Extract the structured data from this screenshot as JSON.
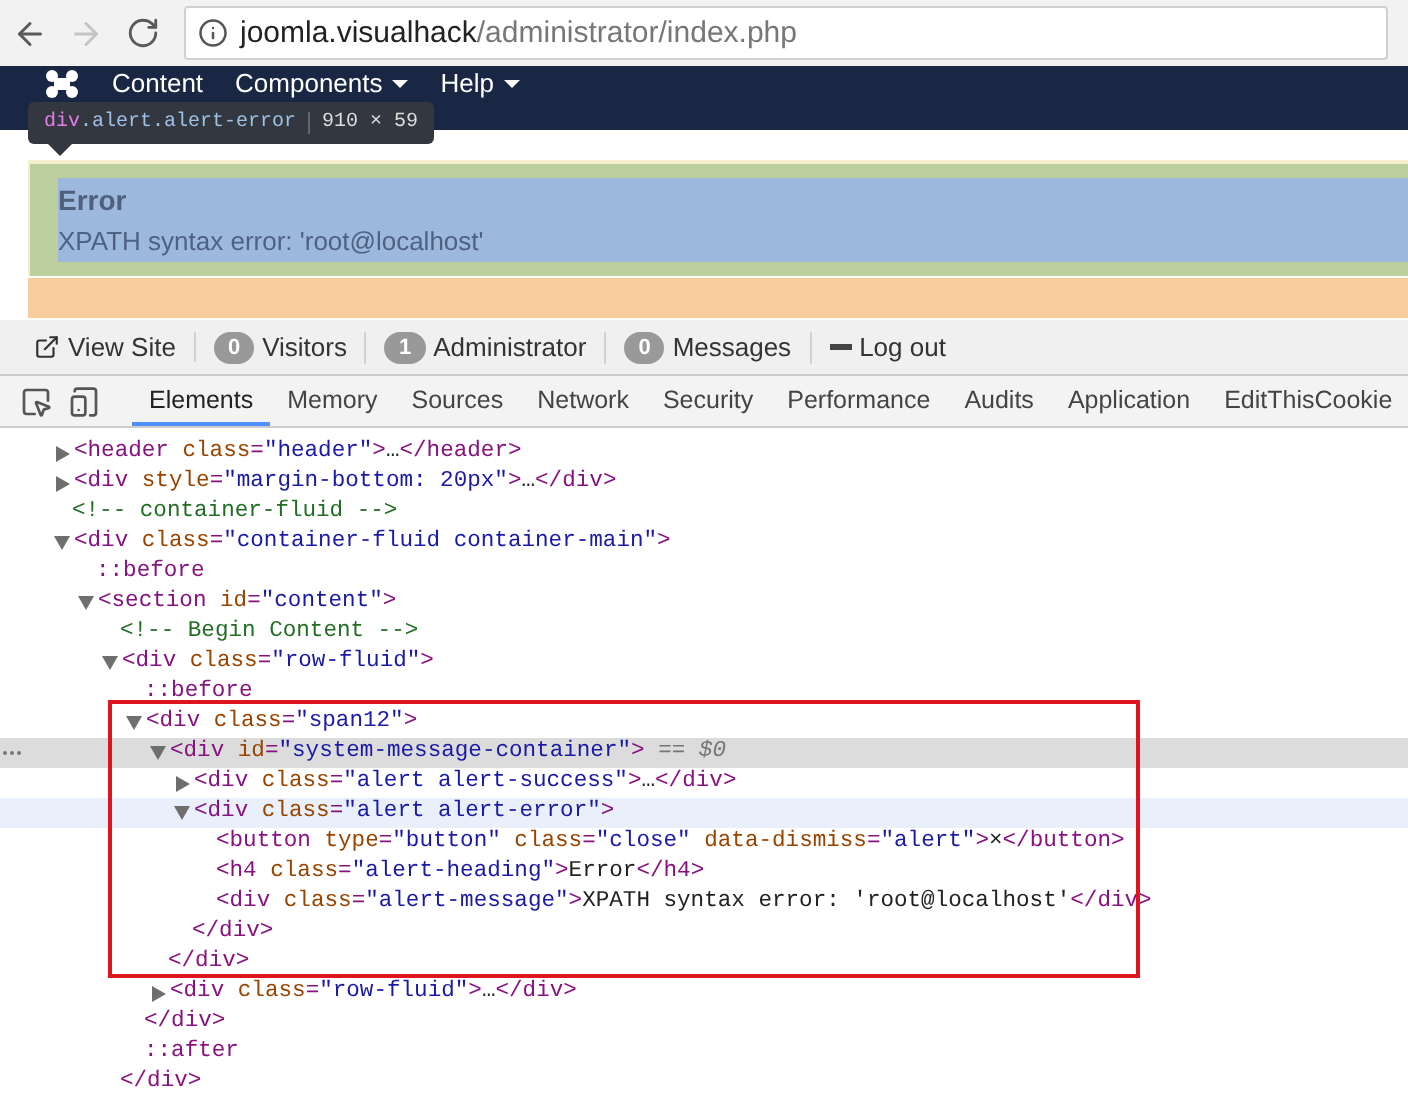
{
  "browser": {
    "back_disabled": false,
    "forward_disabled": true,
    "url_host": "joomla.visualhack",
    "url_path": "/administrator/index.php"
  },
  "navbar": {
    "items": [
      {
        "label": "Content",
        "dropdown": false
      },
      {
        "label": "Components",
        "dropdown": true
      },
      {
        "label": "Help",
        "dropdown": true
      }
    ]
  },
  "inspect_tooltip": {
    "tag": "div",
    "classes": ".alert.alert-error",
    "size": "910 × 59"
  },
  "alert": {
    "heading": "Error",
    "message": "XPATH syntax error: 'root@localhost'"
  },
  "status_bar": [
    {
      "kind": "link",
      "label": "View Site"
    },
    {
      "kind": "count",
      "count": "0",
      "label": "Visitors"
    },
    {
      "kind": "count",
      "count": "1",
      "label": "Administrator"
    },
    {
      "kind": "count",
      "count": "0",
      "label": "Messages"
    },
    {
      "kind": "logout",
      "label": "Log out"
    }
  ],
  "devtools_tabs": [
    {
      "label": "Elements",
      "selected": true
    },
    {
      "label": "Memory",
      "selected": false
    },
    {
      "label": "Sources",
      "selected": false
    },
    {
      "label": "Network",
      "selected": false
    },
    {
      "label": "Security",
      "selected": false
    },
    {
      "label": "Performance",
      "selected": false
    },
    {
      "label": "Audits",
      "selected": false
    },
    {
      "label": "Application",
      "selected": false
    },
    {
      "label": "EditThisCookie",
      "selected": false
    }
  ],
  "dom": [
    {
      "kind": "element",
      "text": "<header class=\"header\">…</header>",
      "expanded": false,
      "selected": false,
      "hovered": false
    },
    {
      "kind": "element",
      "text": "<div style=\"margin-bottom: 20px\">…</div>",
      "expanded": false,
      "selected": false,
      "hovered": false
    },
    {
      "kind": "comment",
      "text": "<!-- container-fluid -->",
      "selected": false,
      "hovered": false
    },
    {
      "kind": "element",
      "text": "<div class=\"container-fluid container-main\">",
      "expanded": true,
      "selected": false,
      "hovered": false,
      "children": [
        {
          "kind": "pseudo",
          "text": "::before",
          "selected": false,
          "hovered": false
        },
        {
          "kind": "element",
          "text": "<section id=\"content\">",
          "expanded": true,
          "selected": false,
          "hovered": false,
          "children": [
            {
              "kind": "comment",
              "text": "<!-- Begin Content -->",
              "selected": false,
              "hovered": false
            },
            {
              "kind": "element",
              "text": "<div class=\"row-fluid\">",
              "expanded": true,
              "selected": false,
              "hovered": false,
              "closing": "</div>",
              "children": [
                {
                  "kind": "pseudo",
                  "text": "::before",
                  "selected": false,
                  "hovered": false
                },
                {
                  "kind": "element",
                  "text": "<div class=\"span12\">",
                  "expanded": true,
                  "selected": false,
                  "hovered": false,
                  "closing": "</div>",
                  "children": [
                    {
                      "kind": "element",
                      "text": "<div id=\"system-message-container\">",
                      "suffix": " == $0",
                      "expanded": true,
                      "selected": true,
                      "hovered": false,
                      "closing": "</div>",
                      "children": [
                        {
                          "kind": "element",
                          "text": "<div class=\"alert alert-success\">…</div>",
                          "expanded": false,
                          "selected": false,
                          "hovered": false
                        },
                        {
                          "kind": "element",
                          "text": "<div class=\"alert alert-error\">",
                          "expanded": true,
                          "selected": false,
                          "hovered": true,
                          "closing": "</div>",
                          "children": [
                            {
                              "kind": "element",
                              "text": "<button type=\"button\" class=\"close\" data-dismiss=\"alert\">×</button>",
                              "selected": false,
                              "hovered": false
                            },
                            {
                              "kind": "element",
                              "text": "<h4 class=\"alert-heading\">Error</h4>",
                              "selected": false,
                              "hovered": false
                            },
                            {
                              "kind": "element",
                              "text": "<div class=\"alert-message\">XPATH syntax error: 'root@localhost'</div>",
                              "selected": false,
                              "hovered": false
                            }
                          ]
                        }
                      ]
                    },
                    {
                      "kind": "element",
                      "text": "<div class=\"row-fluid\">…</div>",
                      "expanded": false,
                      "selected": false,
                      "hovered": false
                    }
                  ]
                },
                {
                  "kind": "pseudo",
                  "text": "::after",
                  "selected": false,
                  "hovered": false
                }
              ]
            }
          ]
        }
      ]
    }
  ]
}
